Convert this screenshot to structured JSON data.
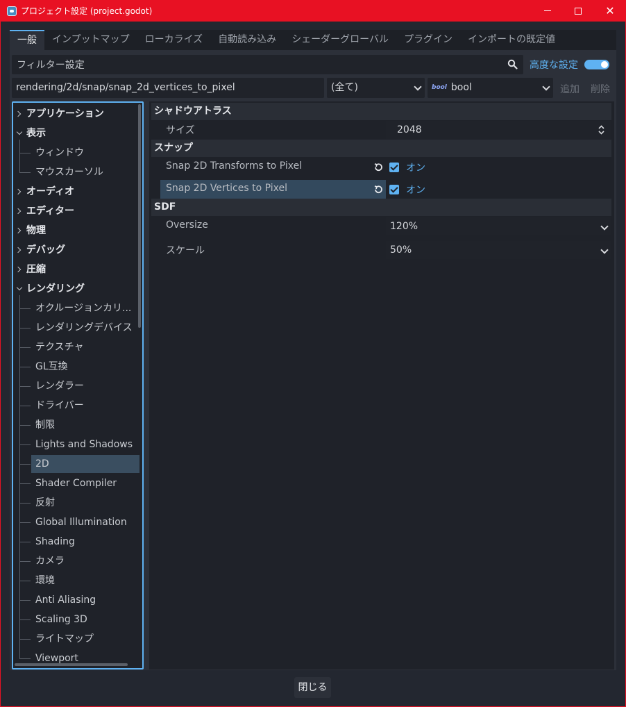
{
  "window": {
    "title": "プロジェクト設定 (project.godot)",
    "min": "–",
    "max": "□",
    "close": "✕"
  },
  "tabs": [
    "一般",
    "インプットマップ",
    "ローカライズ",
    "自動読み込み",
    "シェーダーグローバル",
    "プラグイン",
    "インポートの既定値"
  ],
  "filter": {
    "placeholder": "フィルター設定",
    "advanced_label": "高度な設定",
    "advanced_on": true
  },
  "path_input": {
    "value": "rendering/2d/snap/snap_2d_vertices_to_pixel"
  },
  "type_filter": {
    "value": "(全て)"
  },
  "type_select": {
    "icon_text": "bool",
    "value": "bool"
  },
  "buttons": {
    "add": "追加",
    "delete": "削除",
    "close": "閉じる"
  },
  "tree": [
    {
      "label": "アプリケーション",
      "kind": "parent",
      "expanded": false
    },
    {
      "label": "表示",
      "kind": "parent",
      "expanded": true
    },
    {
      "label": "ウィンドウ",
      "kind": "child"
    },
    {
      "label": "マウスカーソル",
      "kind": "child"
    },
    {
      "label": "オーディオ",
      "kind": "parent",
      "expanded": false
    },
    {
      "label": "エディター",
      "kind": "parent",
      "expanded": false
    },
    {
      "label": "物理",
      "kind": "parent",
      "expanded": false
    },
    {
      "label": "デバッグ",
      "kind": "parent",
      "expanded": false
    },
    {
      "label": "圧縮",
      "kind": "parent",
      "expanded": false
    },
    {
      "label": "レンダリング",
      "kind": "parent",
      "expanded": true
    },
    {
      "label": "オクルージョンカリ...",
      "kind": "child"
    },
    {
      "label": "レンダリングデバイス",
      "kind": "child"
    },
    {
      "label": "テクスチャ",
      "kind": "child"
    },
    {
      "label": "GL互換",
      "kind": "child"
    },
    {
      "label": "レンダラー",
      "kind": "child"
    },
    {
      "label": "ドライバー",
      "kind": "child"
    },
    {
      "label": "制限",
      "kind": "child"
    },
    {
      "label": "Lights and Shadows",
      "kind": "child"
    },
    {
      "label": "2D",
      "kind": "child",
      "selected": true
    },
    {
      "label": "Shader Compiler",
      "kind": "child"
    },
    {
      "label": "反射",
      "kind": "child"
    },
    {
      "label": "Global Illumination",
      "kind": "child"
    },
    {
      "label": "Shading",
      "kind": "child"
    },
    {
      "label": "カメラ",
      "kind": "child"
    },
    {
      "label": "環境",
      "kind": "child"
    },
    {
      "label": "Anti Aliasing",
      "kind": "child"
    },
    {
      "label": "Scaling 3D",
      "kind": "child"
    },
    {
      "label": "ライトマップ",
      "kind": "child"
    },
    {
      "label": "Viewport",
      "kind": "child"
    }
  ],
  "inspector": {
    "shadow_atlas": {
      "title": "シャドウアトラス",
      "size_label": "サイズ",
      "size_value": "2048"
    },
    "snap": {
      "title": "スナップ",
      "transforms_label": "Snap 2D Transforms to Pixel",
      "transforms_value": "オン",
      "vertices_label": "Snap 2D Vertices to Pixel",
      "vertices_value": "オン"
    },
    "sdf": {
      "title": "SDF",
      "oversize_label": "Oversize",
      "oversize_value": "120%",
      "scale_label": "スケール",
      "scale_value": "50%"
    }
  }
}
